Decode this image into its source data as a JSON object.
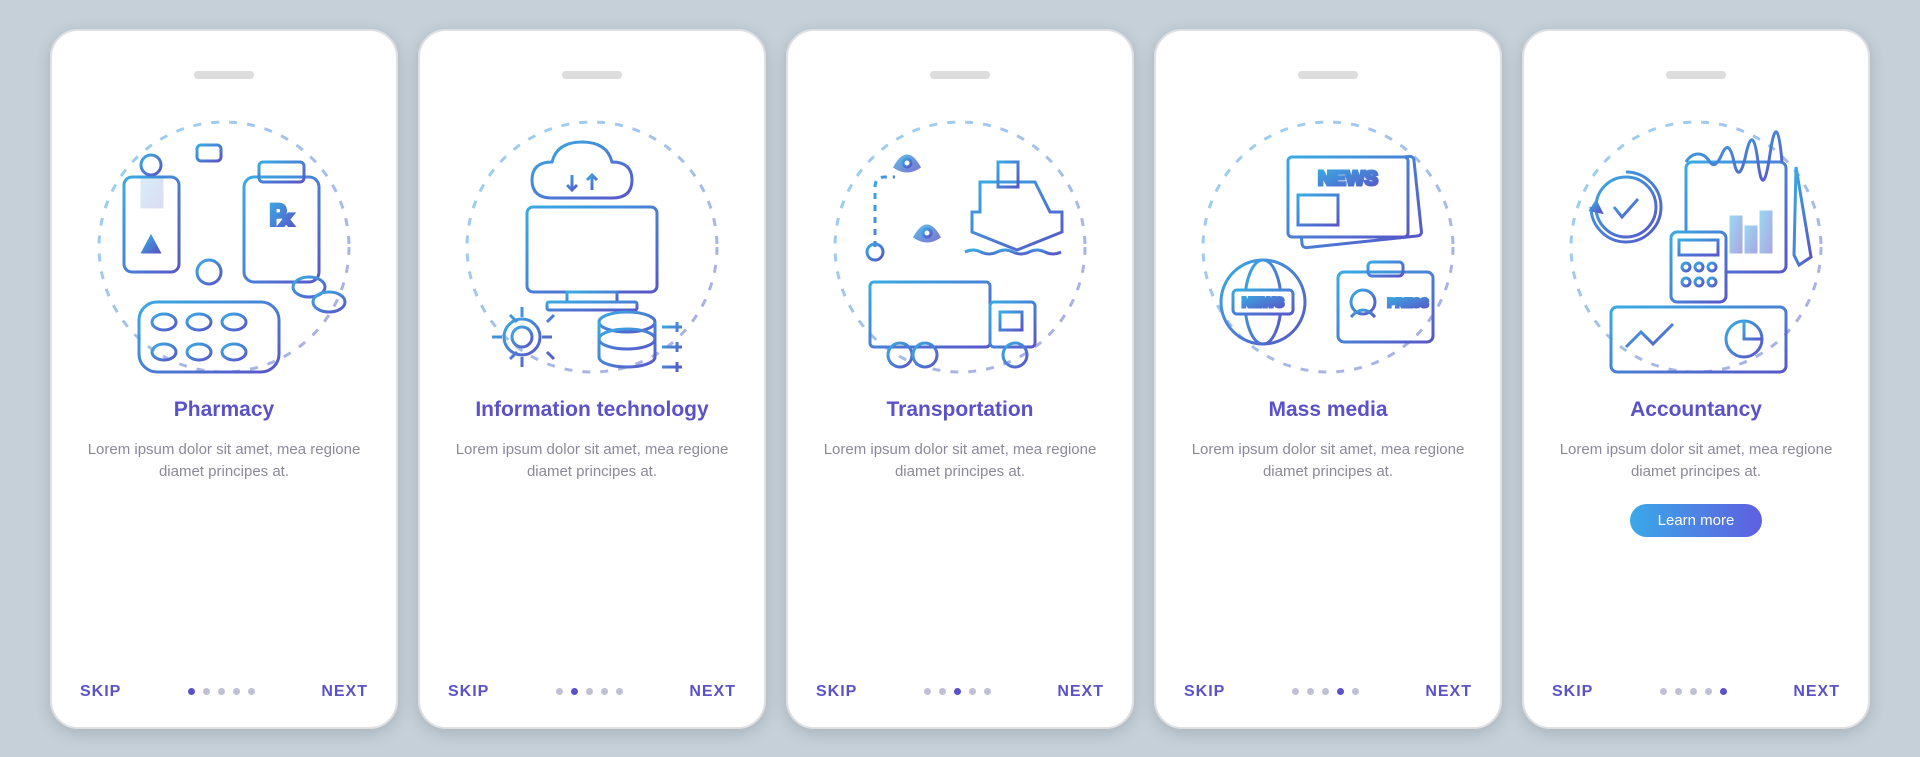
{
  "controls": {
    "skip": "SKIP",
    "next": "NEXT",
    "learn": "Learn more"
  },
  "desc": "Lorem ipsum dolor sit amet, mea regione diamet principes at.",
  "screens": [
    {
      "title": "Pharmacy",
      "icon": "pharmacy-icon",
      "active": 0,
      "learn": false
    },
    {
      "title": "Information technology",
      "icon": "it-icon",
      "active": 1,
      "learn": false
    },
    {
      "title": "Transportation",
      "icon": "transport-icon",
      "active": 2,
      "learn": false
    },
    {
      "title": "Mass media",
      "icon": "media-icon",
      "active": 3,
      "learn": false
    },
    {
      "title": "Accountancy",
      "icon": "accountancy-icon",
      "active": 4,
      "learn": true
    }
  ]
}
